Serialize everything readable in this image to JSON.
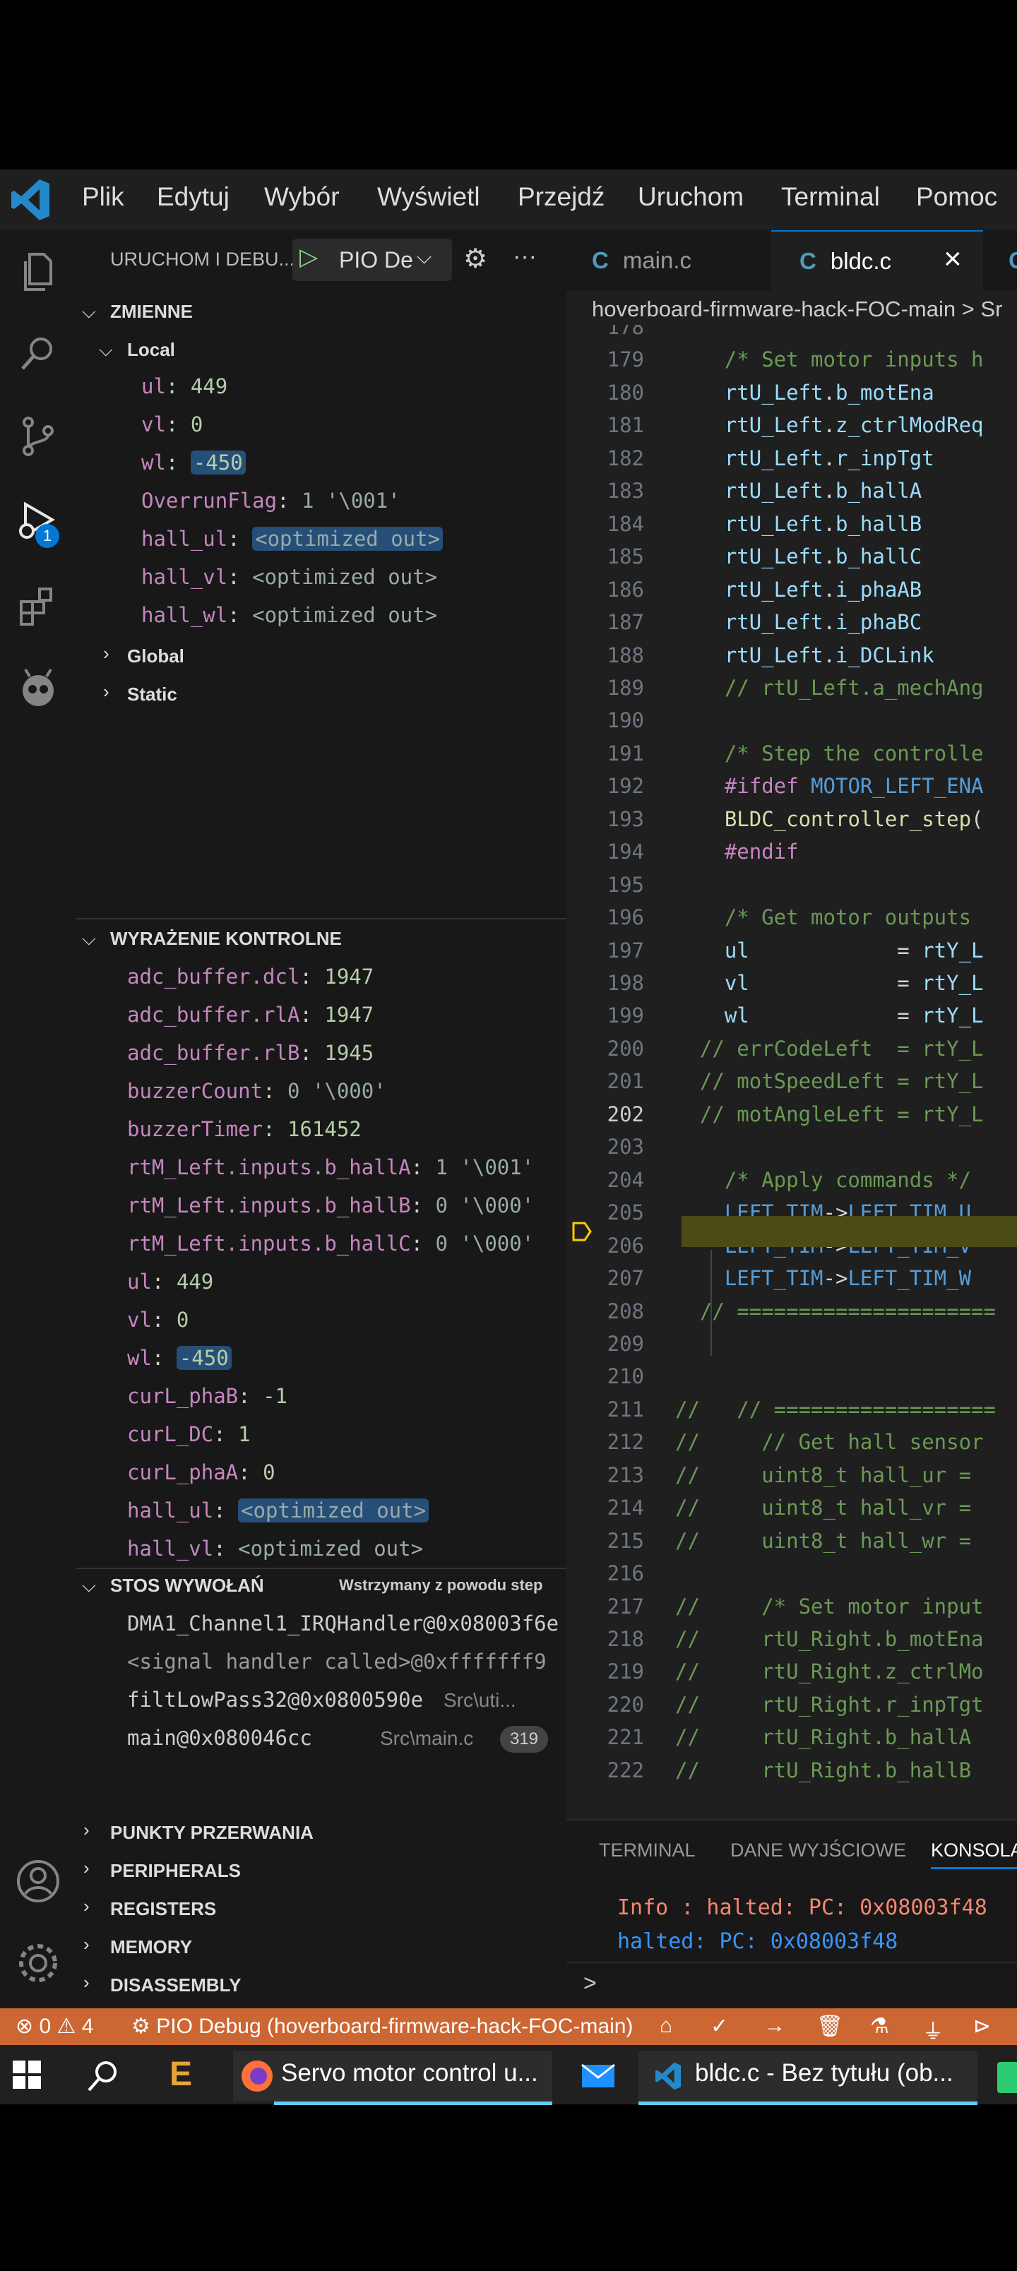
{
  "menu": [
    "Plik",
    "Edytuj",
    "Wybór",
    "Wyświetl",
    "Przejdź",
    "Uruchom",
    "Terminal",
    "Pomoc"
  ],
  "debug_header": {
    "title": "URUCHOM I DEBU...",
    "config": "PIO De"
  },
  "variables": {
    "section": "ZMIENNE",
    "local_label": "Local",
    "local": [
      {
        "name": "ul",
        "value": "449"
      },
      {
        "name": "vl",
        "value": "0"
      },
      {
        "name": "wl",
        "value": "-450"
      },
      {
        "name": "OverrunFlag",
        "value": "1 '\\001'"
      },
      {
        "name": "hall_ul",
        "value": "<optimized out>"
      },
      {
        "name": "hall_vl",
        "value": "<optimized out>"
      },
      {
        "name": "hall_wl",
        "value": "<optimized out>"
      }
    ],
    "global_label": "Global",
    "static_label": "Static"
  },
  "watch": {
    "section": "WYRAŻENIE KONTROLNE",
    "items": [
      {
        "name": "adc_buffer.dcl",
        "value": "1947"
      },
      {
        "name": "adc_buffer.rlA",
        "value": "1947"
      },
      {
        "name": "adc_buffer.rlB",
        "value": "1945"
      },
      {
        "name": "buzzerCount",
        "value": "0 '\\000'"
      },
      {
        "name": "buzzerTimer",
        "value": "161452"
      },
      {
        "name": "rtM_Left.inputs.b_hallA",
        "value": "1 '\\001'"
      },
      {
        "name": "rtM_Left.inputs.b_hallB",
        "value": "0 '\\000'"
      },
      {
        "name": "rtM_Left.inputs.b_hallC",
        "value": "0 '\\000'"
      },
      {
        "name": "ul",
        "value": "449"
      },
      {
        "name": "vl",
        "value": "0"
      },
      {
        "name": "wl",
        "value": "-450"
      },
      {
        "name": "curL_phaB",
        "value": "-1"
      },
      {
        "name": "curL_DC",
        "value": "1"
      },
      {
        "name": "curL_phaA",
        "value": "0"
      },
      {
        "name": "hall_ul",
        "value": "<optimized out>"
      },
      {
        "name": "hall_vl",
        "value": "<optimized out>"
      }
    ]
  },
  "callstack": {
    "section": "STOS WYWOŁAŃ",
    "status": "Wstrzymany z powodu step",
    "frames": [
      {
        "fn": "DMA1_Channel1_IRQHandler@0x08003f6e",
        "file": "",
        "line": ""
      },
      {
        "fn": "<signal handler called>@0xfffffff9",
        "file": "",
        "line": ""
      },
      {
        "fn": "filtLowPass32@0x0800590e",
        "file": "Src\\uti...",
        "line": ""
      },
      {
        "fn": "main@0x080046cc",
        "file": "Src\\main.c",
        "line": "319"
      }
    ]
  },
  "collapsed_sections": [
    "PUNKTY PRZERWANIA",
    "PERIPHERALS",
    "REGISTERS",
    "MEMORY",
    "DISASSEMBLY"
  ],
  "tabs": [
    {
      "label": "main.c",
      "active": false
    },
    {
      "label": "bldc.c",
      "active": true
    }
  ],
  "tab_close": "×",
  "breadcrumb": "hoverboard-firmware-hack-FOC-main > Sr",
  "code_lines": [
    {
      "n": "178",
      "text": ""
    },
    {
      "n": "179",
      "text": "    /* Set motor inputs h"
    },
    {
      "n": "180",
      "text": "    rtU_Left.b_motEna"
    },
    {
      "n": "181",
      "text": "    rtU_Left.z_ctrlModReq"
    },
    {
      "n": "182",
      "text": "    rtU_Left.r_inpTgt"
    },
    {
      "n": "183",
      "text": "    rtU_Left.b_hallA"
    },
    {
      "n": "184",
      "text": "    rtU_Left.b_hallB"
    },
    {
      "n": "185",
      "text": "    rtU_Left.b_hallC"
    },
    {
      "n": "186",
      "text": "    rtU_Left.i_phaAB"
    },
    {
      "n": "187",
      "text": "    rtU_Left.i_phaBC"
    },
    {
      "n": "188",
      "text": "    rtU_Left.i_DCLink"
    },
    {
      "n": "189",
      "text": "    // rtU_Left.a_mechAng"
    },
    {
      "n": "190",
      "text": ""
    },
    {
      "n": "191",
      "text": "    /* Step the controlle"
    },
    {
      "n": "192",
      "text": "    #ifdef MOTOR_LEFT_ENA"
    },
    {
      "n": "193",
      "text": "    BLDC_controller_step("
    },
    {
      "n": "194",
      "text": "    #endif"
    },
    {
      "n": "195",
      "text": ""
    },
    {
      "n": "196",
      "text": "    /* Get motor outputs"
    },
    {
      "n": "197",
      "text": "    ul            = rtY_L"
    },
    {
      "n": "198",
      "text": "    vl            = rtY_L"
    },
    {
      "n": "199",
      "text": "    wl            = rtY_L"
    },
    {
      "n": "200",
      "text": "  // errCodeLeft  = rtY_L"
    },
    {
      "n": "201",
      "text": "  // motSpeedLeft = rtY_L"
    },
    {
      "n": "202",
      "text": "  // motAngleLeft = rtY_L"
    },
    {
      "n": "203",
      "text": ""
    },
    {
      "n": "204",
      "text": "    /* Apply commands */"
    },
    {
      "n": "205",
      "text": "    LEFT_TIM->LEFT_TIM_U"
    },
    {
      "n": "206",
      "text": "    LEFT_TIM->LEFT_TIM_V"
    },
    {
      "n": "207",
      "text": "    LEFT_TIM->LEFT_TIM_W"
    },
    {
      "n": "208",
      "text": "  // ====================="
    },
    {
      "n": "209",
      "text": ""
    },
    {
      "n": "210",
      "text": ""
    },
    {
      "n": "211",
      "text": "//   // =================="
    },
    {
      "n": "212",
      "text": "//     // Get hall sensor"
    },
    {
      "n": "213",
      "text": "//     uint8_t hall_ur ="
    },
    {
      "n": "214",
      "text": "//     uint8_t hall_vr ="
    },
    {
      "n": "215",
      "text": "//     uint8_t hall_wr ="
    },
    {
      "n": "216",
      "text": ""
    },
    {
      "n": "217",
      "text": "//     /* Set motor input"
    },
    {
      "n": "218",
      "text": "//     rtU_Right.b_motEna"
    },
    {
      "n": "219",
      "text": "//     rtU_Right.z_ctrlMo"
    },
    {
      "n": "220",
      "text": "//     rtU_Right.r_inpTgt"
    },
    {
      "n": "221",
      "text": "//     rtU_Right.b_hallA"
    },
    {
      "n": "222",
      "text": "//     rtU_Right.b_hallB"
    }
  ],
  "panel": {
    "tabs": [
      "TERMINAL",
      "DANE WYJŚCIOWE",
      "KONSOLA"
    ],
    "lines": [
      "Info : halted: PC: 0x08003f48",
      "halted: PC: 0x08003f48"
    ],
    "prompt": ">"
  },
  "statusbar": {
    "errors": "0",
    "warnings": "4",
    "debug": "PIO Debug (hoverboard-firmware-hack-FOC-main)"
  },
  "taskbar": {
    "firefox": "Servo motor control u...",
    "vscode": "bldc.c - Bez tytułu (ob..."
  },
  "debug_badge": "1",
  "colors": {
    "statusbar": "#cc6633",
    "accent": "#0078d4"
  }
}
